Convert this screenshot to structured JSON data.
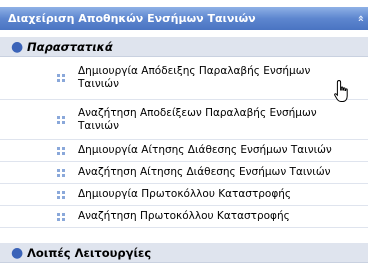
{
  "header": {
    "title": "Διαχείριση Αποθηκών Ενσήμων Ταινιών",
    "collapse_glyph": "»"
  },
  "sections": [
    {
      "title": "Παραστατικά"
    },
    {
      "title": "Λοιπές Λειτουργίες"
    }
  ],
  "items": [
    {
      "label": "Δημιουργία Απόδειξης Παραλαβής Ενσήμων Ταινιών"
    },
    {
      "label": "Αναζήτηση Αποδείξεων Παραλαβής Ενσήμων Ταινιών"
    },
    {
      "label": "Δημιουργία Αίτησης Διάθεσης Ενσήμων Ταινιών"
    },
    {
      "label": "Αναζήτηση Αίτησης Διάθεσης Ενσήμων Ταινιών"
    },
    {
      "label": "Δημιουργία Πρωτοκόλλου Καταστροφής"
    },
    {
      "label": "Αναζήτηση Πρωτοκόλλου Καταστροφής"
    }
  ],
  "colors": {
    "header_gradient_top": "#8fb1e6",
    "header_gradient_bottom": "#4a74c2",
    "section_background": "#dfe4ee",
    "bullet": "#3b63b8",
    "item_icon": "#8aa8da"
  },
  "icons": {
    "collapse": "double-chevron-up-icon",
    "section_bullet": "bullet-icon",
    "item": "grid-dots-icon",
    "cursor": "hand-pointer-cursor"
  }
}
